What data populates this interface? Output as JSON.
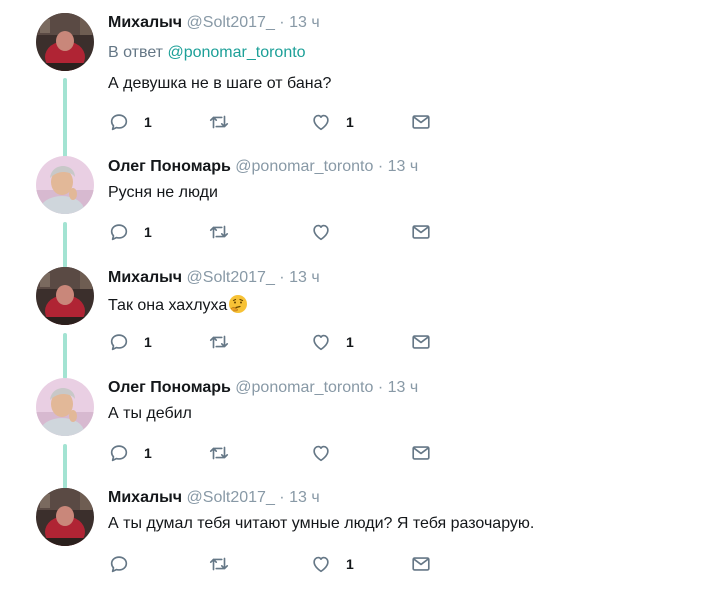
{
  "tweets": [
    {
      "name": "Михалыч",
      "handle": "@Solt2017_",
      "dot": "·",
      "time": "13 ч",
      "reply_prefix": "В ответ",
      "reply_handle": "@ponomar_toronto",
      "text": "А девушка не в шаге от бана?",
      "reply_count": "1",
      "retweet_count": "",
      "like_count": "1"
    },
    {
      "name": "Олег Пономарь",
      "handle": "@ponomar_toronto",
      "dot": "·",
      "time": "13 ч",
      "text": "Русня не люди",
      "reply_count": "1",
      "retweet_count": "",
      "like_count": ""
    },
    {
      "name": "Михалыч",
      "handle": "@Solt2017_",
      "dot": "·",
      "time": "13 ч",
      "text": "Так она хахлуха",
      "emoji": "thinking-face",
      "reply_count": "1",
      "retweet_count": "",
      "like_count": "1"
    },
    {
      "name": "Олег Пономарь",
      "handle": "@ponomar_toronto",
      "dot": "·",
      "time": "13 ч",
      "text": "А ты дебил",
      "reply_count": "1",
      "retweet_count": "",
      "like_count": ""
    },
    {
      "name": "Михалыч",
      "handle": "@Solt2017_",
      "dot": "·",
      "time": "13 ч",
      "text": "А ты думал тебя читают умные люди? Я тебя разочарую.",
      "reply_count": "",
      "retweet_count": "",
      "like_count": "1"
    }
  ],
  "colors": {
    "thread_line": "#a3e3d2",
    "link": "#1da098",
    "muted": "#8899a6",
    "icon": "#657786"
  },
  "icons": [
    "reply-icon",
    "retweet-icon",
    "like-icon",
    "direct-message-icon"
  ]
}
